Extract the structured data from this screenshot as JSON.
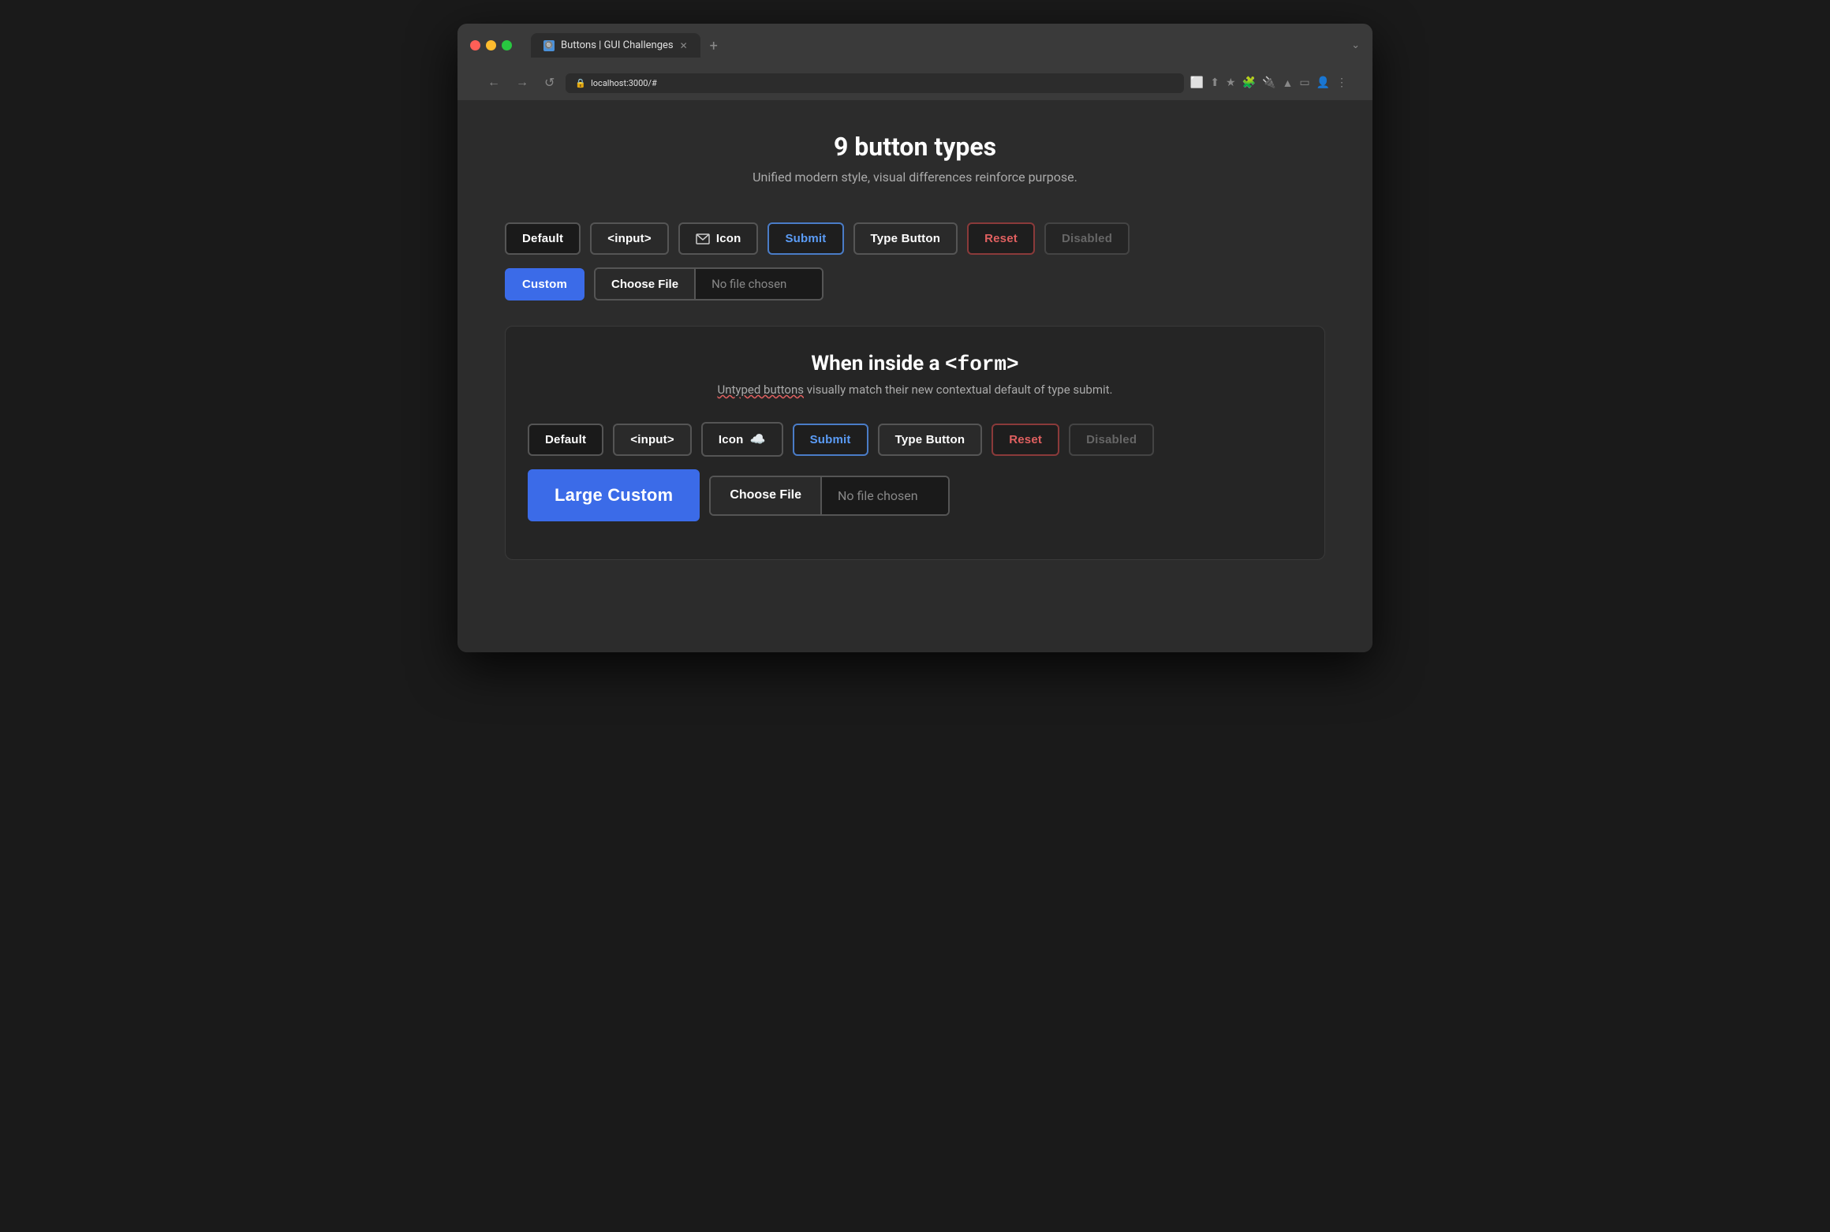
{
  "browser": {
    "tab_title": "Buttons | GUI Challenges",
    "url": "localhost:3000/#",
    "new_tab_label": "+",
    "back_label": "←",
    "forward_label": "→",
    "reload_label": "↺",
    "more_label": "⋮",
    "dropdown_label": "⌄"
  },
  "page": {
    "title": "9 button types",
    "subtitle": "Unified modern style, visual differences reinforce purpose."
  },
  "top_buttons": {
    "default_label": "Default",
    "input_label": "<input>",
    "icon_label": "Icon",
    "submit_label": "Submit",
    "type_button_label": "Type Button",
    "reset_label": "Reset",
    "disabled_label": "Disabled",
    "custom_label": "Custom",
    "choose_file_label": "Choose File",
    "no_file_chosen": "No file chosen"
  },
  "form_section": {
    "title_prefix": "When inside a ",
    "title_code": "<form>",
    "subtitle_normal": " visually match their new contextual default of type submit.",
    "subtitle_underlined": "Untyped buttons",
    "default_label": "Default",
    "input_label": "<input>",
    "icon_label": "Icon",
    "submit_label": "Submit",
    "type_button_label": "Type Button",
    "reset_label": "Reset",
    "disabled_label": "Disabled",
    "large_custom_label": "Large Custom",
    "choose_file_label": "Choose File",
    "no_file_chosen": "No file chosen"
  }
}
